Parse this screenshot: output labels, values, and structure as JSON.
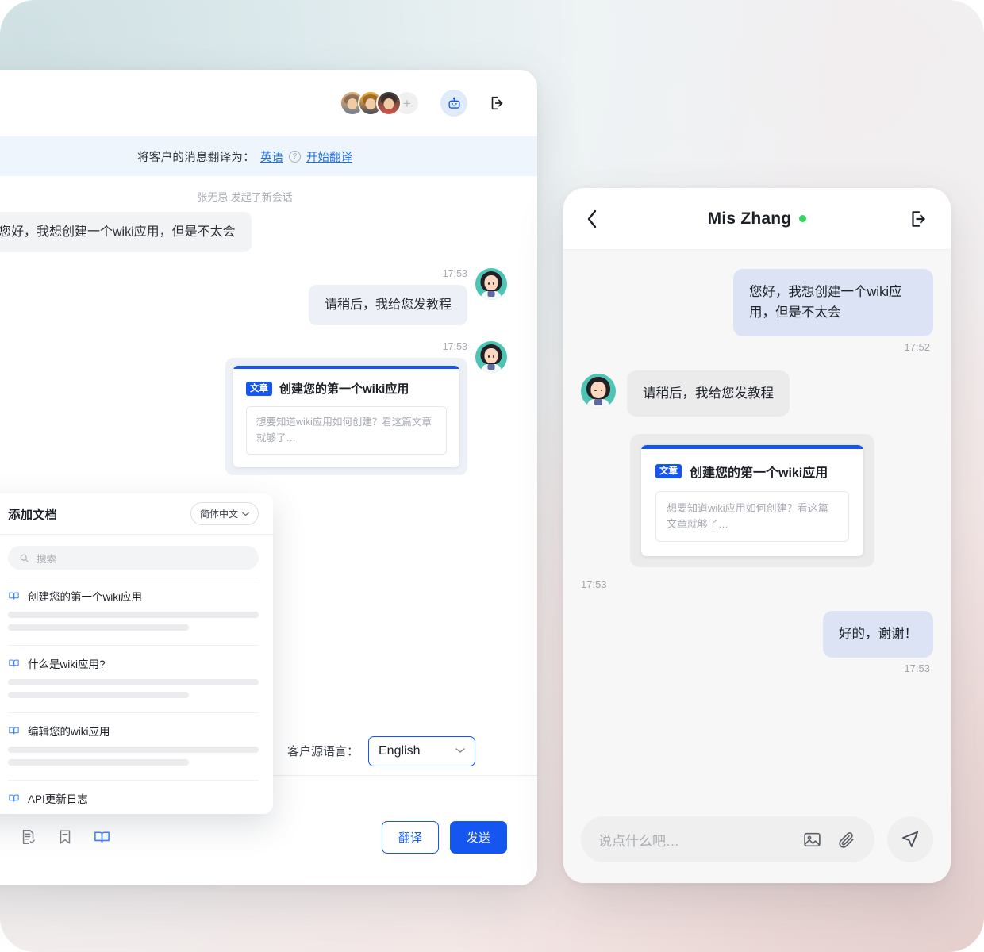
{
  "theme": {
    "accent": "#1456ef",
    "link": "#1f6fe0",
    "online_dot": "#2fd65f",
    "translate_bar_bg": "#eff5fd",
    "bubble_me_bg": "#dbe3f5",
    "bubble_them_bg": "#ebebec",
    "avatar_bg": "#4ec5b4"
  },
  "desktop": {
    "header": {
      "avatar_count_label": "+",
      "bot_icon": "robot-icon",
      "exit_icon": "exit-icon"
    },
    "translate_bar": {
      "label": "将客户的消息翻译为：",
      "language_link": "英语",
      "help_icon": "question-icon",
      "start_link": "开始翻译"
    },
    "system_note": "张无忌 发起了新会话",
    "messages": [
      {
        "side": "left",
        "type": "text",
        "text": "您好，我想创建一个wiki应用，但是不太会",
        "time": ""
      },
      {
        "side": "right",
        "type": "text",
        "text": "请稍后，我给您发教程",
        "time": "17:53"
      },
      {
        "side": "right",
        "type": "card",
        "time": "17:53"
      }
    ],
    "article_card": {
      "tag": "文章",
      "title": "创建您的第一个wiki应用",
      "excerpt": "想要知道wiki应用如何创建？看这篇文章就够了…"
    },
    "source_language": {
      "label": "客户源语言：",
      "value": "English",
      "chevron": "chevron-down-icon"
    },
    "composer": {
      "tools": [
        {
          "name": "attachment-icon",
          "active": false
        },
        {
          "name": "quick-reply-icon",
          "active": false
        },
        {
          "name": "bookmark-icon",
          "active": false
        },
        {
          "name": "knowledge-book-icon",
          "active": true
        }
      ],
      "translate_label": "翻译",
      "send_label": "发送"
    }
  },
  "add_doc": {
    "title": "添加文档",
    "language": "简体中文",
    "language_chevron": "chevron-down-icon",
    "search_placeholder": "搜索",
    "search_icon": "search-icon",
    "items": [
      {
        "icon": "book-icon",
        "title": "创建您的第一个wiki应用"
      },
      {
        "icon": "book-icon",
        "title": "什么是wiki应用?"
      },
      {
        "icon": "book-icon",
        "title": "编辑您的wiki应用"
      },
      {
        "icon": "book-icon",
        "title": "API更新日志"
      }
    ]
  },
  "mobile": {
    "header": {
      "back_icon": "chevron-left-icon",
      "title": "Mis Zhang",
      "status": "online",
      "exit_icon": "exit-icon"
    },
    "messages": [
      {
        "side": "right",
        "type": "text",
        "text": "您好，我想创建一个wiki应用，但是不太会",
        "time": "17:52"
      },
      {
        "side": "left",
        "type": "text",
        "text": "请稍后，我给您发教程",
        "time": ""
      },
      {
        "side": "left",
        "type": "card",
        "time": "17:53"
      },
      {
        "side": "right",
        "type": "text",
        "text": "好的，谢谢！",
        "time": "17:53"
      }
    ],
    "article_card": {
      "tag": "文章",
      "title": "创建您的第一个wiki应用",
      "excerpt": "想要知道wiki应用如何创建？看这篇文章就够了…"
    },
    "composer": {
      "placeholder": "说点什么吧…",
      "image_icon": "image-icon",
      "attachment_icon": "attachment-icon",
      "send_icon": "send-icon"
    }
  }
}
